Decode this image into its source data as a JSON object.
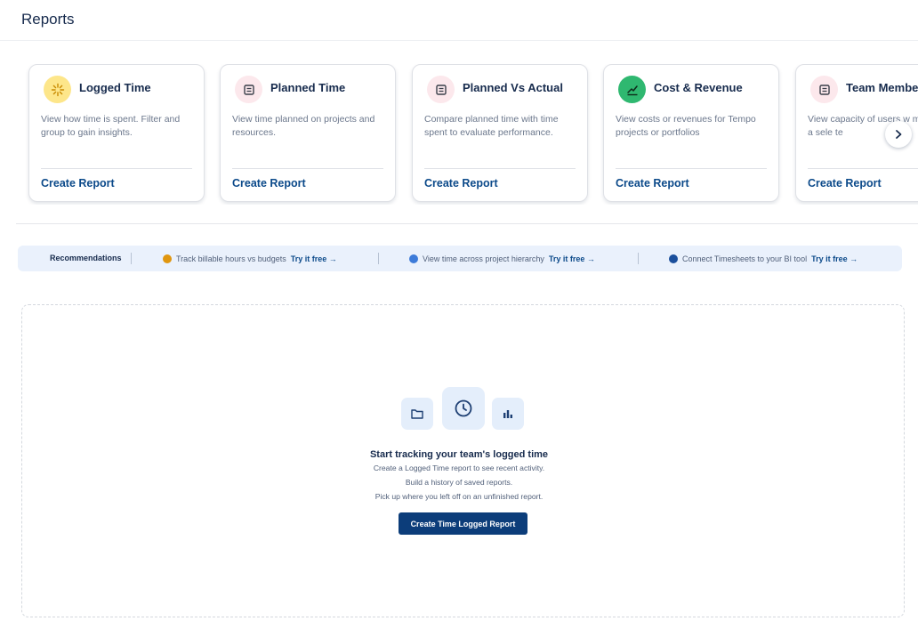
{
  "header": {
    "title": "Reports"
  },
  "cards": [
    {
      "title": "Logged Time",
      "description": "View how time is spent. Filter and group to gain insights.",
      "cta": "Create Report",
      "icon": "sparkle-icon",
      "icon_bg": "#fde68a"
    },
    {
      "title": "Planned Time",
      "description": "View time planned on projects and resources.",
      "cta": "Create Report",
      "icon": "document-icon",
      "icon_bg": "#fce8ec"
    },
    {
      "title": "Planned Vs Actual",
      "description": "Compare planned time with time spent to evaluate performance.",
      "cta": "Create Report",
      "icon": "document-icon",
      "icon_bg": "#fce8ec"
    },
    {
      "title": "Cost & Revenue",
      "description": "View costs or revenues for Tempo projects or portfolios",
      "cta": "Create Report",
      "icon": "trend-chart-icon",
      "icon_bg": "#2fb870"
    },
    {
      "title": "Team Member",
      "description": "View capacity of users w members of a sele   te",
      "cta": "Create Report",
      "icon": "document-icon",
      "icon_bg": "#fce8ec"
    }
  ],
  "carousel": {
    "next_icon": "chevron-right-icon"
  },
  "recommendations": {
    "label": "Recommendations",
    "items": [
      {
        "text": "Track billable hours vs budgets",
        "link": "Try it free →",
        "dot_color": "#e0960f"
      },
      {
        "text": "View time across project hierarchy",
        "link": "Try it free →",
        "dot_color": "#3d7bd9"
      },
      {
        "text": "Connect Timesheets to your BI tool",
        "link": "Try it free →",
        "dot_color": "#1b4f9c"
      }
    ]
  },
  "empty_state": {
    "icons": [
      "folder-icon",
      "clock-icon",
      "bar-chart-icon"
    ],
    "title": "Start tracking your team's logged time",
    "lines": [
      "Create a Logged Time report to see recent activity.",
      "Build a history of saved reports.",
      "Pick up where you left off on an unfinished report."
    ],
    "button": "Create Time Logged Report"
  },
  "colors": {
    "accent": "#0c4a8a",
    "button": "#0c3d7a",
    "reco_bg": "#eaf1fc"
  }
}
